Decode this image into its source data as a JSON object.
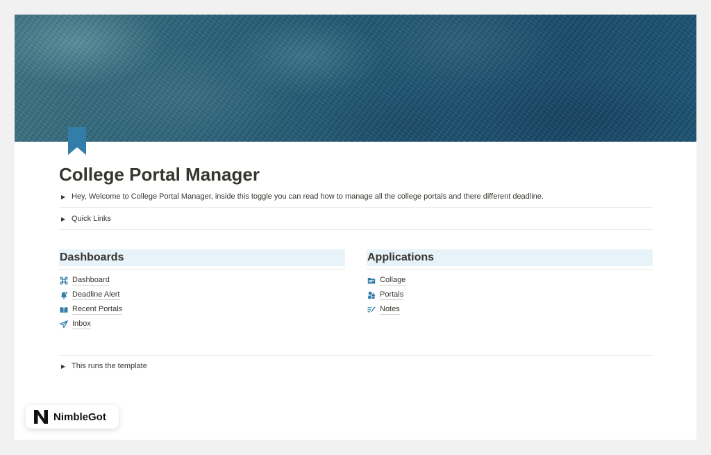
{
  "page": {
    "title": "College Portal Manager",
    "icon": "bookmark-icon",
    "cover": "dark teal textured cover"
  },
  "toggles": [
    {
      "label": "Hey, Welcome to College Portal Manager, inside this toggle you can read how to manage all the college portals and there different deadline."
    },
    {
      "label": "Quick Links"
    }
  ],
  "columns": {
    "dashboards": {
      "heading": "Dashboards",
      "items": [
        {
          "label": "Dashboard",
          "icon": "command-icon"
        },
        {
          "label": "Deadline Alert",
          "icon": "bell-alert-icon"
        },
        {
          "label": "Recent Portals",
          "icon": "open-book-icon"
        },
        {
          "label": "Inbox",
          "icon": "paper-plane-icon"
        }
      ]
    },
    "applications": {
      "heading": "Applications",
      "items": [
        {
          "label": "Collage",
          "icon": "folder-icon"
        },
        {
          "label": "Portals",
          "icon": "shapes-icon"
        },
        {
          "label": "Notes",
          "icon": "notes-pencil-icon"
        }
      ]
    }
  },
  "footer_toggle": {
    "label": "This runs the template"
  },
  "brand": {
    "name": "NimbleGot",
    "logo": "n-logo-icon"
  },
  "colors": {
    "accent_icon": "#337ea9",
    "header_bg": "#e7f3f8",
    "text": "#37352f"
  }
}
